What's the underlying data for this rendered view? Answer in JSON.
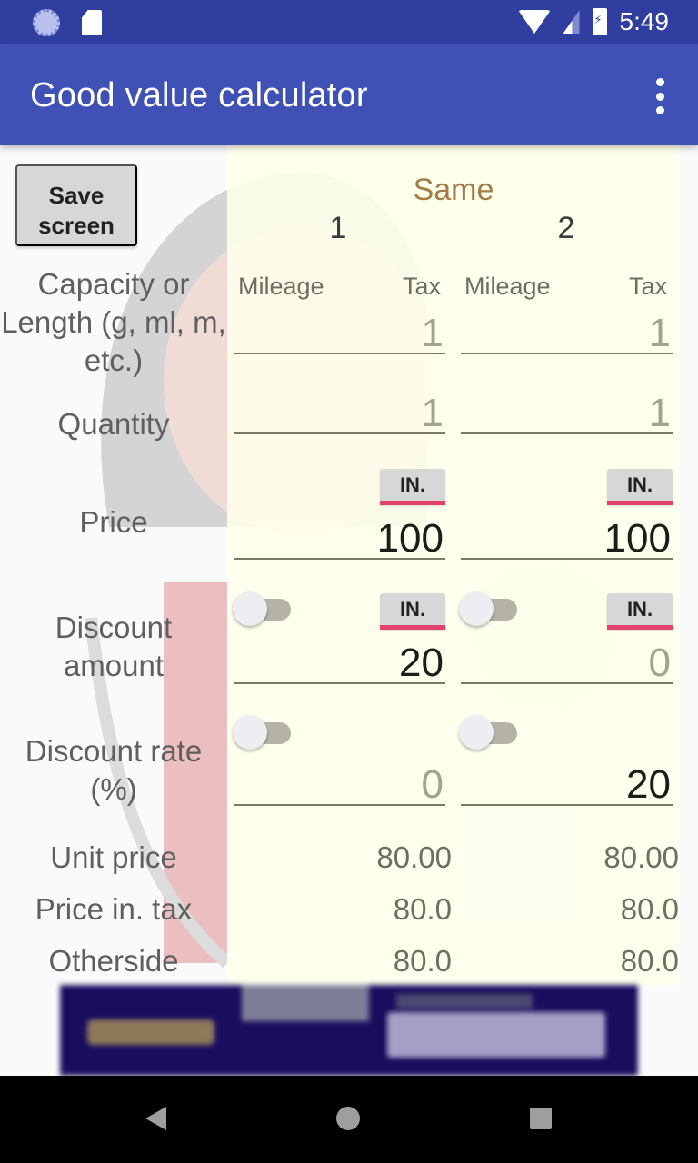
{
  "status_bar": {
    "time": "5:49",
    "icons": [
      "sync-icon",
      "sd-card-icon",
      "wifi-icon",
      "signal-icon",
      "battery-charging-icon"
    ]
  },
  "app_bar": {
    "title": "Good value calculator",
    "menu_icon": "more-vert-icon"
  },
  "toolbar": {
    "save_label": "Save screen"
  },
  "header": {
    "same_label": "Same",
    "columns": [
      "1",
      "2"
    ],
    "sub_labels": {
      "mileage": "Mileage",
      "tax": "Tax"
    }
  },
  "rows": {
    "capacity": "Capacity or Length (g, ml, m, etc.)",
    "quantity": "Quantity",
    "price": "Price",
    "discount_amount": "Discount amount",
    "discount_rate": "Discount rate (%)",
    "unit_price": "Unit price",
    "price_in_tax": "Price in. tax",
    "otherside": "Otherside"
  },
  "tax_button_label": "IN.",
  "items": [
    {
      "capacity": "1",
      "quantity": "1",
      "price": "100",
      "discount_amount": "20",
      "discount_amount_toggle": false,
      "discount_rate": "0",
      "discount_rate_toggle": false,
      "unit_price": "80.00",
      "price_in_tax": "80.0",
      "otherside": "80.0"
    },
    {
      "capacity": "1",
      "quantity": "1",
      "price": "100",
      "discount_amount": "0",
      "discount_amount_toggle": false,
      "discount_rate": "20",
      "discount_rate_toggle": false,
      "unit_price": "80.00",
      "price_in_tax": "80.0",
      "otherside": "80.0"
    }
  ],
  "nav_bar": {
    "icons": [
      "back-icon",
      "home-icon",
      "recents-icon"
    ]
  },
  "colors": {
    "status_bar": "#303f9f",
    "app_bar": "#3f51b5",
    "accent": "#e2426d",
    "panel": "#ffffec",
    "same_label": "#a57c45"
  }
}
